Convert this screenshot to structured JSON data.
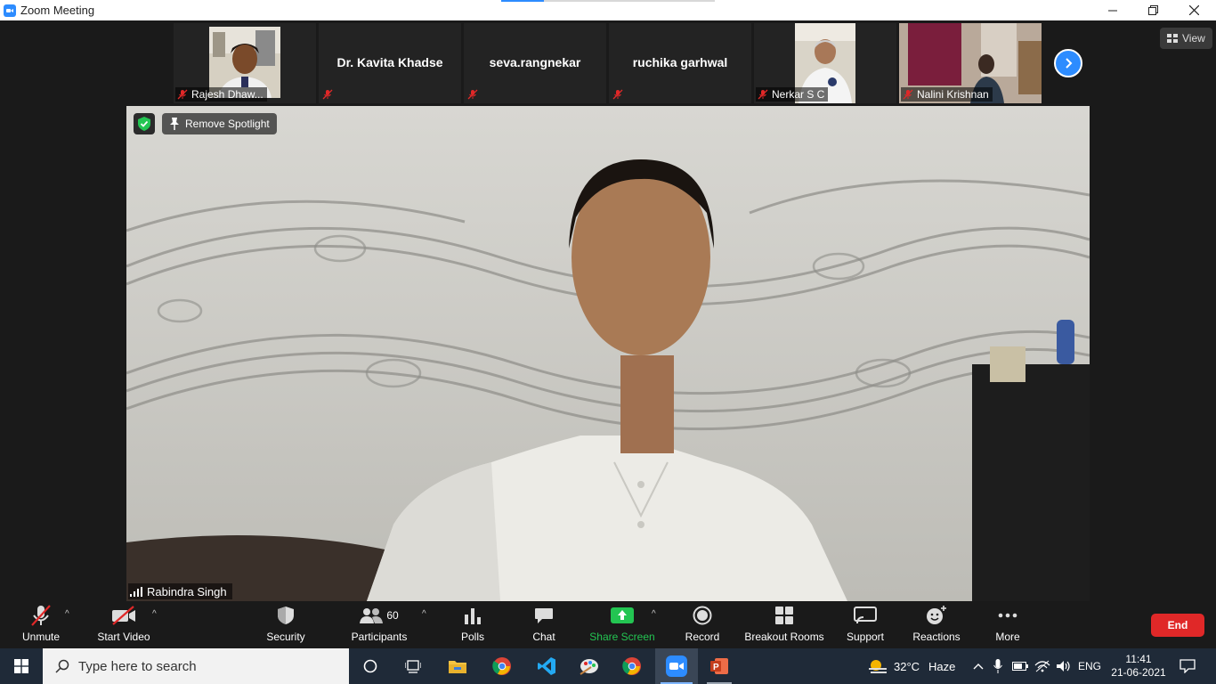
{
  "window": {
    "title": "Zoom Meeting",
    "minimize_icon": "minimize-icon",
    "restore_icon": "restore-icon",
    "close_icon": "close-icon"
  },
  "thumbnails": [
    {
      "name": "Rajesh Dhaw...",
      "has_video": true,
      "muted": true
    },
    {
      "name": "Dr. Kavita Khadse",
      "has_video": false,
      "muted": true
    },
    {
      "name": "seva.rangnekar",
      "has_video": false,
      "muted": true
    },
    {
      "name": "ruchika garhwal",
      "has_video": false,
      "muted": true
    },
    {
      "name": "Nerkar S C",
      "has_video": true,
      "muted": true
    },
    {
      "name": "Nalini Krishnan",
      "has_video": true,
      "muted": true
    }
  ],
  "view_button": {
    "label": "View"
  },
  "main": {
    "spotlight_label": "Remove Spotlight",
    "speaker_name": "Rabindra Singh"
  },
  "toolbar": {
    "unmute": "Unmute",
    "start_video": "Start Video",
    "security": "Security",
    "participants": "Participants",
    "participants_count": "60",
    "polls": "Polls",
    "chat": "Chat",
    "share_screen": "Share Screen",
    "record": "Record",
    "breakout_rooms": "Breakout Rooms",
    "support": "Support",
    "reactions": "Reactions",
    "more": "More",
    "end": "End"
  },
  "taskbar": {
    "search_placeholder": "Type here to search",
    "weather_temp": "32°C",
    "weather_desc": "Haze",
    "language": "ENG",
    "time": "11:41",
    "date": "21-06-2021"
  },
  "colors": {
    "accent": "#2d8cff",
    "share_green": "#23c552",
    "end_red": "#e02828",
    "muted_red": "#e02828"
  }
}
